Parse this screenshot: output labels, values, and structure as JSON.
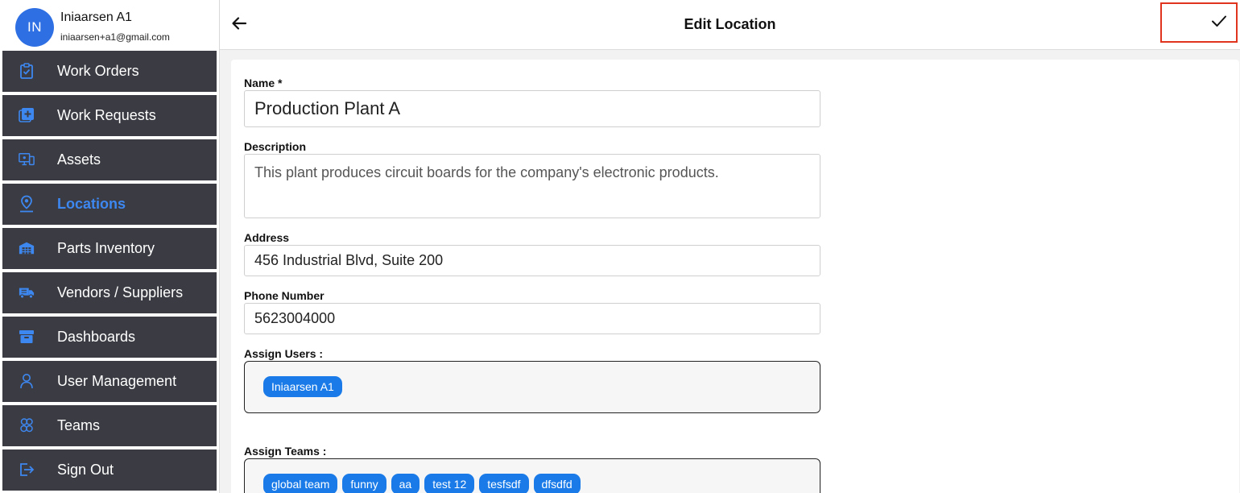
{
  "profile": {
    "initials": "IN",
    "name": "Iniaarsen A1",
    "email": "iniaarsen+a1@gmail.com",
    "avatar_color": "#2f6fe4"
  },
  "sidebar": {
    "items": [
      {
        "label": "Work Orders",
        "icon": "clipboard-check-icon",
        "active": false
      },
      {
        "label": "Work Requests",
        "icon": "plus-square-icon",
        "active": false
      },
      {
        "label": "Assets",
        "icon": "monitor-icon",
        "active": false
      },
      {
        "label": "Locations",
        "icon": "map-pin-icon",
        "active": true
      },
      {
        "label": "Parts Inventory",
        "icon": "warehouse-icon",
        "active": false
      },
      {
        "label": "Vendors / Suppliers",
        "icon": "truck-icon",
        "active": false
      },
      {
        "label": "Dashboards",
        "icon": "archive-box-icon",
        "active": false
      },
      {
        "label": "User Management",
        "icon": "user-icon",
        "active": false
      },
      {
        "label": "Teams",
        "icon": "team-icon",
        "active": false
      },
      {
        "label": "Sign Out",
        "icon": "sign-out-icon",
        "active": false
      }
    ],
    "bg_color": "#3b3c43",
    "active_color": "#3d87f0",
    "icon_color": "#3d87f0"
  },
  "header": {
    "title": "Edit Location"
  },
  "form": {
    "name": {
      "label": "Name *",
      "value": "Production Plant A"
    },
    "description": {
      "label": "Description",
      "value": "This plant produces circuit boards for the company's electronic products."
    },
    "address": {
      "label": "Address",
      "value": "456 Industrial Blvd, Suite 200"
    },
    "phone": {
      "label": "Phone Number",
      "value": "5623004000"
    },
    "assign_users": {
      "label": "Assign Users :",
      "chips": [
        "Iniaarsen A1"
      ]
    },
    "assign_teams": {
      "label": "Assign Teams :",
      "chips": [
        "global team",
        "funny",
        "aa",
        "test 12",
        "tesfsdf",
        "dfsdfd"
      ]
    }
  },
  "colors": {
    "chip": "#1a7be8",
    "highlight": "#e0341f"
  }
}
